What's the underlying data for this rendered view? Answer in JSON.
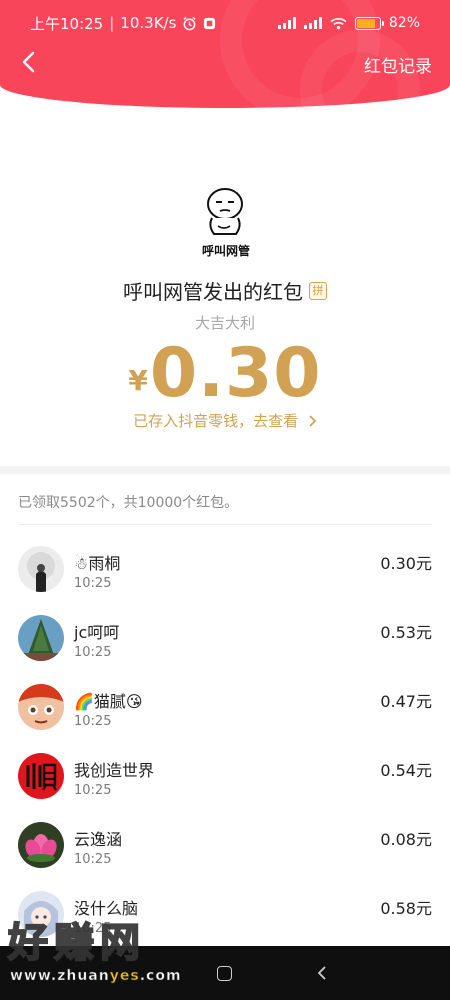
{
  "status_bar": {
    "time": "上午10:25",
    "speed": "10.3K/s",
    "battery": "82%",
    "battery_level": 0.82,
    "alarm_icon": "alarm-icon",
    "wifi_icon": "wifi-icon"
  },
  "header": {
    "back_icon": "back-arrow-icon",
    "records_label": "红包记录",
    "color": "#f9455a"
  },
  "sender": {
    "avatar_caption": "呼叫网管",
    "title": "呼叫网管发出的红包",
    "badge": "拼",
    "blessing": "大吉大利"
  },
  "amount": {
    "currency": "¥",
    "value": "0.30",
    "saved_link": "已存入抖音零钱，去查看",
    "color": "#d1a253"
  },
  "summary": "已领取5502个，共10000个红包。",
  "recipients": [
    {
      "name": "☃雨桐",
      "time": "10:25",
      "amount": "0.30元",
      "avatar_color": "#ededed"
    },
    {
      "name": "jc呵呵",
      "time": "10:25",
      "amount": "0.53元",
      "avatar_color": "#3f6f8f"
    },
    {
      "name": "🌈猫腻😘",
      "time": "10:25",
      "amount": "0.47元",
      "avatar_color": "#e7572c"
    },
    {
      "name": "我创造世界",
      "time": "10:25",
      "amount": "0.54元",
      "avatar_color": "#e0161c"
    },
    {
      "name": "云逸涵",
      "time": "10:25",
      "amount": "0.08元",
      "avatar_color": "#3a4a2a"
    },
    {
      "name": "没什么脑",
      "time": "10:25",
      "amount": "0.58元",
      "avatar_color": "#c9d3e6"
    }
  ],
  "watermark": {
    "big": "好赚网",
    "small_prefix": "www.zhuan",
    "small_highlight": "yes",
    "small_suffix": ".com"
  },
  "nav_bar": {
    "home_icon": "home-square-icon",
    "back_icon": "back-triangle-icon"
  }
}
